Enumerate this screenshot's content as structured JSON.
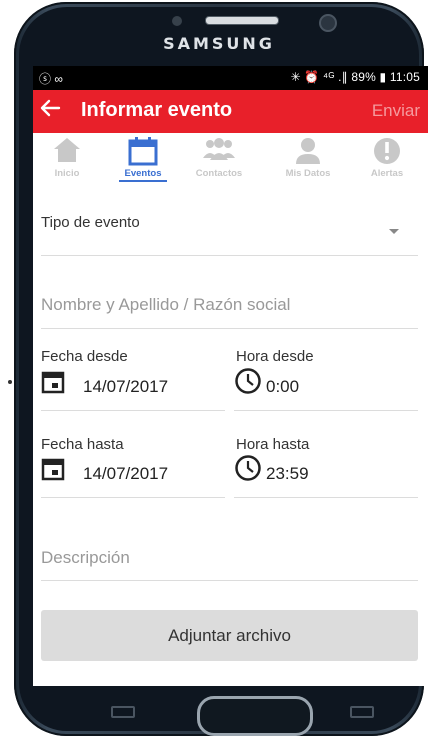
{
  "device": {
    "brand": "SAMSUNG"
  },
  "status_bar": {
    "left_icons": "ⓢ ∞",
    "right_text": "✳ ⏰ ⁴ᴳ .∥ 89% ▮ 11:05"
  },
  "app_bar": {
    "back_icon": "back-arrow-icon",
    "title": "Informar evento",
    "send_label": "Enviar"
  },
  "tabs": [
    {
      "label": "Inicio",
      "icon": "home-icon"
    },
    {
      "label": "Eventos",
      "icon": "calendar-icon",
      "active": true
    },
    {
      "label": "Contactos",
      "icon": "people-icon"
    },
    {
      "label": "Mis Datos",
      "icon": "person-icon"
    },
    {
      "label": "Alertas",
      "icon": "alert-icon"
    }
  ],
  "form": {
    "event_type_placeholder": "Tipo de evento",
    "name_placeholder": "Nombre y Apellido / Razón social",
    "date_from_label": "Fecha desde",
    "date_from_value": "14/07/2017",
    "time_from_label": "Hora desde",
    "time_from_value": "0:00",
    "date_to_label": "Fecha hasta",
    "date_to_value": "14/07/2017",
    "time_to_label": "Hora hasta",
    "time_to_value": "23:59",
    "description_placeholder": "Descripción",
    "attach_label": "Adjuntar archivo"
  },
  "colors": {
    "accent": "#e8202a",
    "tab_active": "#3a6fd1",
    "tab_inactive": "#c8c8c8"
  }
}
